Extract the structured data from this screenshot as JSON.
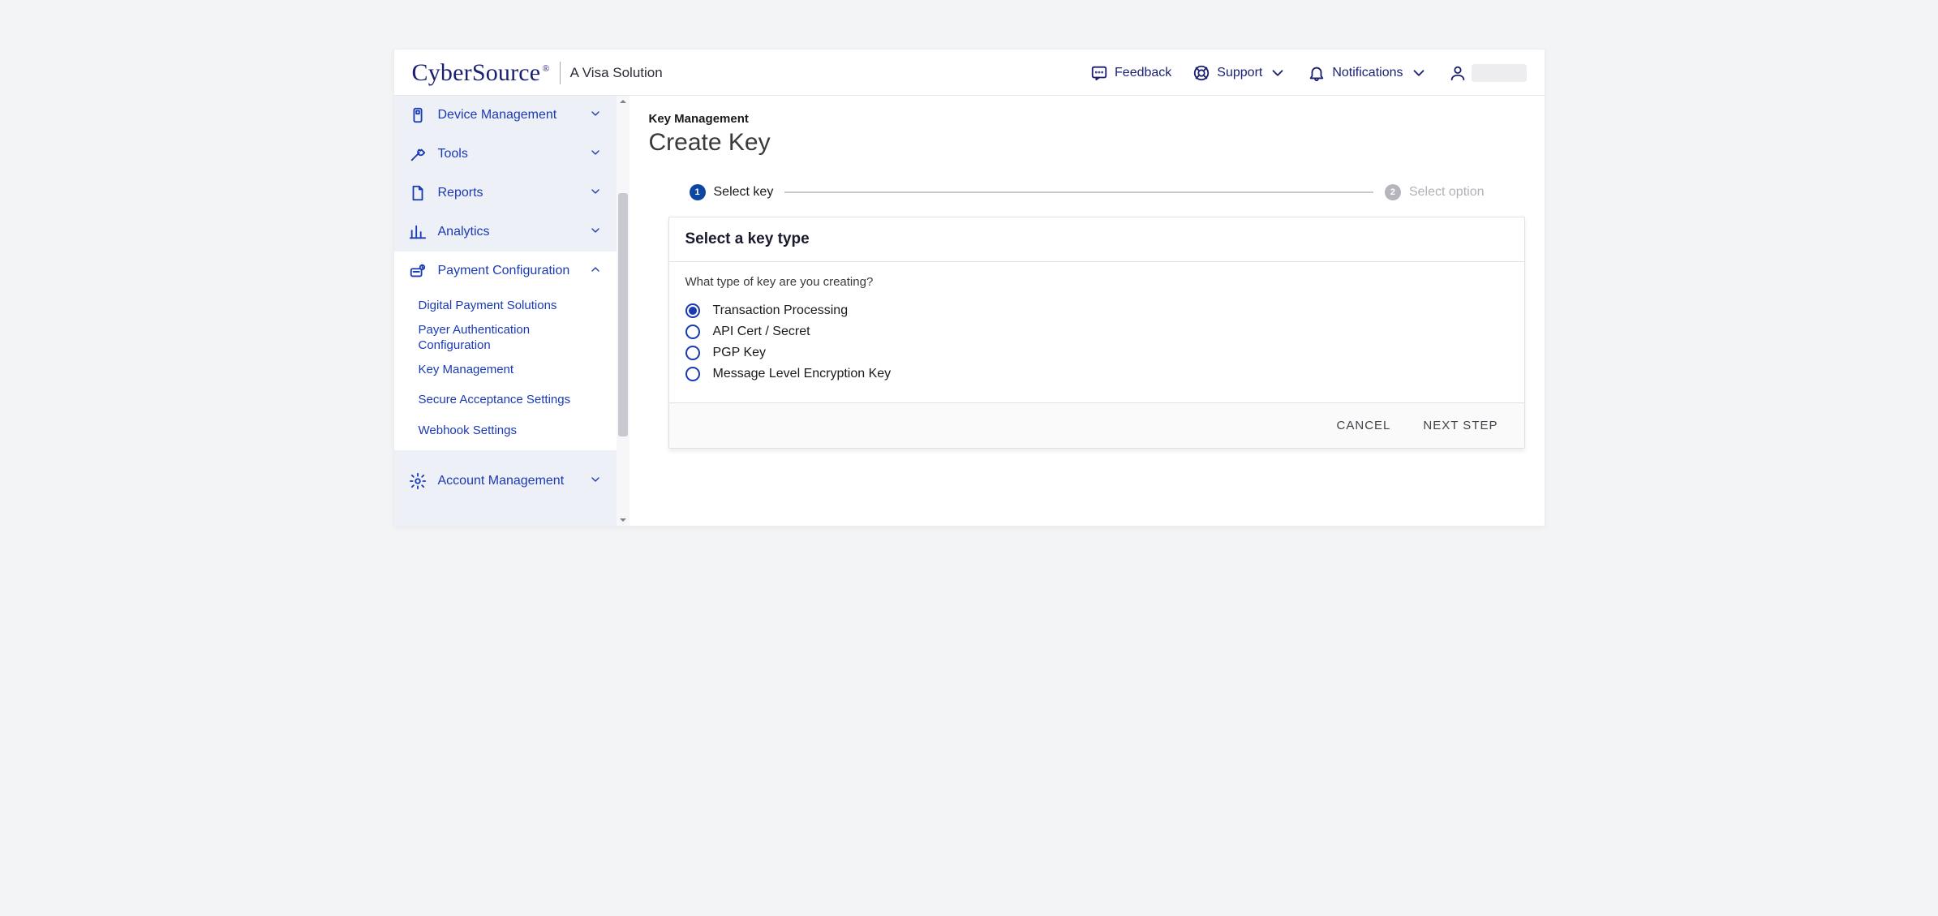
{
  "header": {
    "brand": {
      "name": "CyberSource",
      "sub": "A Visa Solution"
    },
    "links": {
      "feedback": "Feedback",
      "support": "Support",
      "notifications": "Notifications"
    }
  },
  "sidebar": {
    "items": [
      {
        "label": "Device Management"
      },
      {
        "label": "Tools"
      },
      {
        "label": "Reports"
      },
      {
        "label": "Analytics"
      },
      {
        "label": "Payment Configuration"
      },
      {
        "label": "Account Management"
      }
    ],
    "sub": [
      {
        "label": "Digital Payment Solutions"
      },
      {
        "label": "Payer Authentication Configuration"
      },
      {
        "label": "Key Management"
      },
      {
        "label": "Secure Acceptance Settings"
      },
      {
        "label": "Webhook Settings"
      }
    ]
  },
  "main": {
    "breadcrumb": "Key Management",
    "title": "Create Key",
    "steps": [
      {
        "num": "1",
        "label": "Select key"
      },
      {
        "num": "2",
        "label": "Select option"
      }
    ],
    "card": {
      "title": "Select a key type",
      "prompt": "What type of key are you creating?",
      "options": [
        {
          "label": "Transaction Processing",
          "selected": true
        },
        {
          "label": "API Cert / Secret",
          "selected": false
        },
        {
          "label": "PGP Key",
          "selected": false
        },
        {
          "label": "Message Level Encryption Key",
          "selected": false
        }
      ],
      "cancel": "CANCEL",
      "next": "NEXT STEP"
    }
  }
}
